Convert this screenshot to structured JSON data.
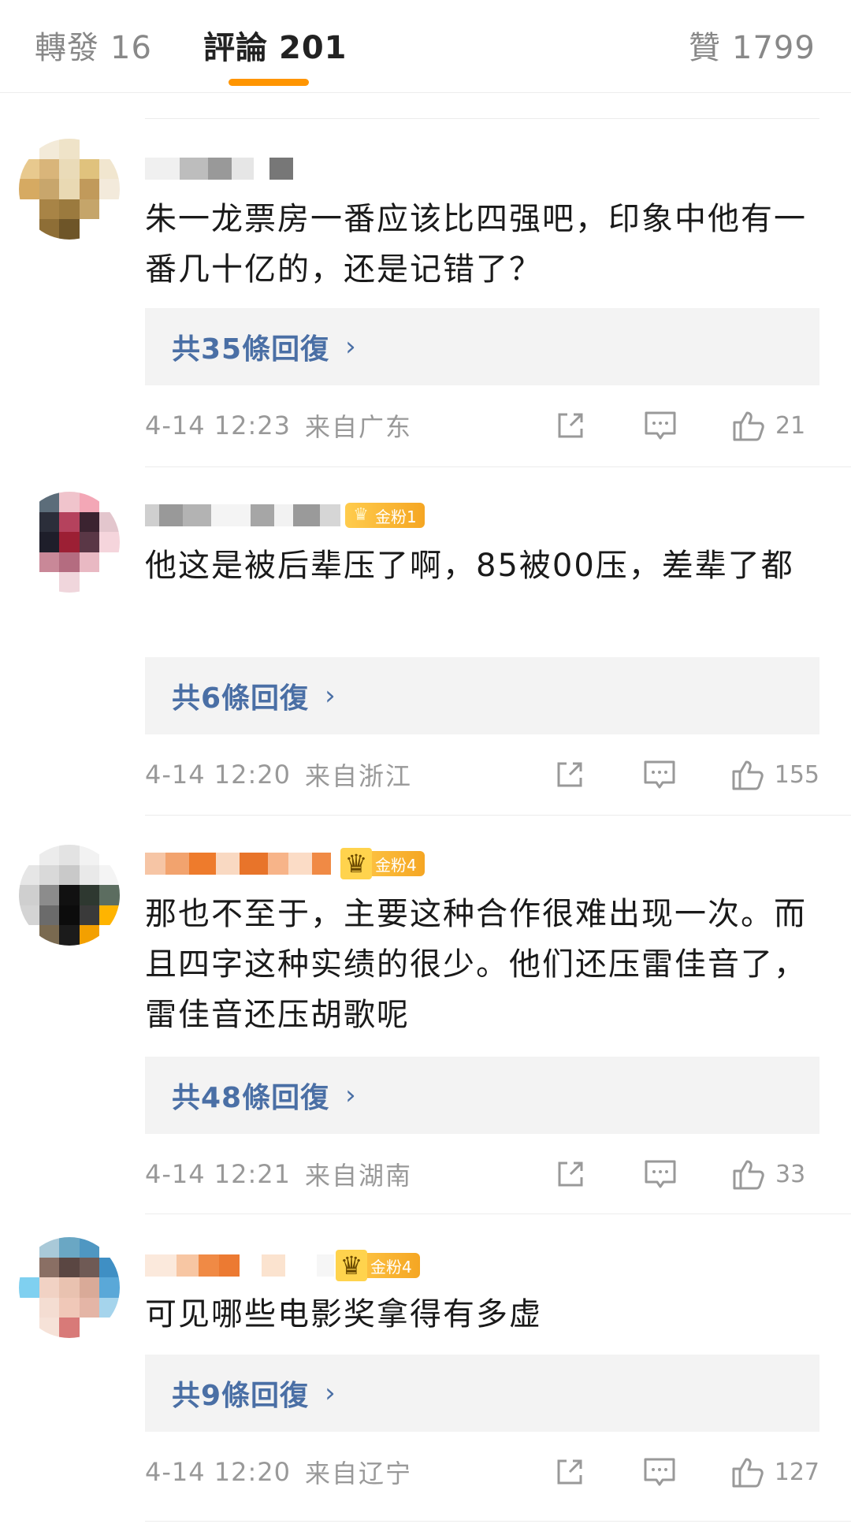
{
  "tabs": [
    {
      "label": "轉發",
      "count": "16"
    },
    {
      "label": "評論",
      "count": "201"
    },
    {
      "label": "贊",
      "count": "1799"
    }
  ],
  "comments": [
    {
      "text": "朱一龙票房一番应该比四强吧，印象中他有一番几十亿的，还是记错了？",
      "badge": "",
      "replies": "共35條回復",
      "time": "4-14 12:23",
      "location": "来自广东",
      "likes": "21"
    },
    {
      "text": "他这是被后辈压了啊，85被00压，差辈了都",
      "badge": "金粉1",
      "replies": "共6條回復",
      "time": "4-14 12:20",
      "location": "来自浙江",
      "likes": "155"
    },
    {
      "text": "那也不至于，主要这种合作很难出现一次。而且四字这种实绩的很少。他们还压雷佳音了，雷佳音还压胡歌呢",
      "badge": "金粉4",
      "replies": "共48條回復",
      "time": "4-14 12:21",
      "location": "来自湖南",
      "likes": "33"
    },
    {
      "text": "可见哪些电影奖拿得有多虚",
      "badge": "金粉4",
      "replies": "共9條回復",
      "time": "4-14 12:20",
      "location": "来自辽宁",
      "likes": "127"
    }
  ],
  "icons": {
    "repost": "share-icon",
    "comment": "comment-icon",
    "like": "thumbs-up-icon",
    "chevron": "chevron-right-icon"
  },
  "colors": {
    "accent": "#ff9500",
    "link": "#4a6fa5",
    "badge": "#f5a623",
    "meta": "#999999"
  }
}
